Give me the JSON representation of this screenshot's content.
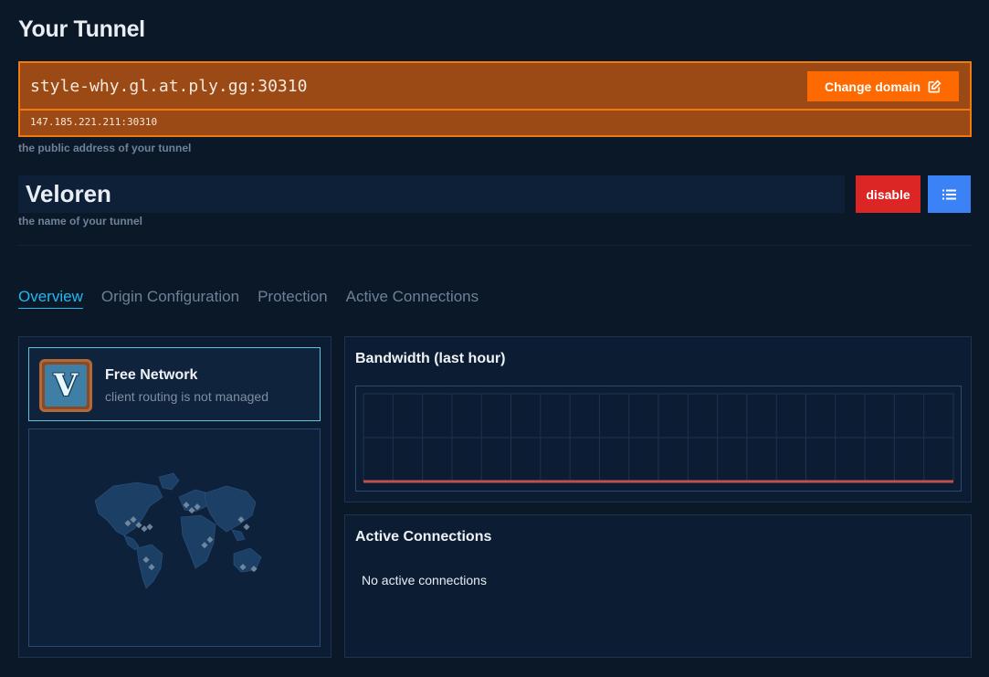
{
  "page": {
    "title": "Your Tunnel"
  },
  "address": {
    "domain": "style-why.gl.at.ply.gg:30310",
    "ip": "147.185.221.211:30310",
    "hint": "the public address of your tunnel",
    "change_domain_label": "Change domain"
  },
  "tunnel": {
    "name": "Veloren",
    "name_hint": "the name of your tunnel",
    "disable_label": "disable"
  },
  "tabs": [
    "Overview",
    "Origin Configuration",
    "Protection",
    "Active Connections"
  ],
  "active_tab": "Overview",
  "network": {
    "logo_letter": "V",
    "title": "Free Network",
    "subtitle": "client routing is not managed"
  },
  "bandwidth": {
    "title": "Bandwidth (last hour)",
    "line_color": "#c0504d"
  },
  "connections": {
    "title": "Active Connections",
    "empty_text": "No active connections"
  },
  "colors": {
    "background": "#0b1828",
    "accent_orange": "#ff6a00",
    "danger": "#dc2626",
    "primary": "#3b82f6",
    "tab_active": "#22b8f0"
  }
}
